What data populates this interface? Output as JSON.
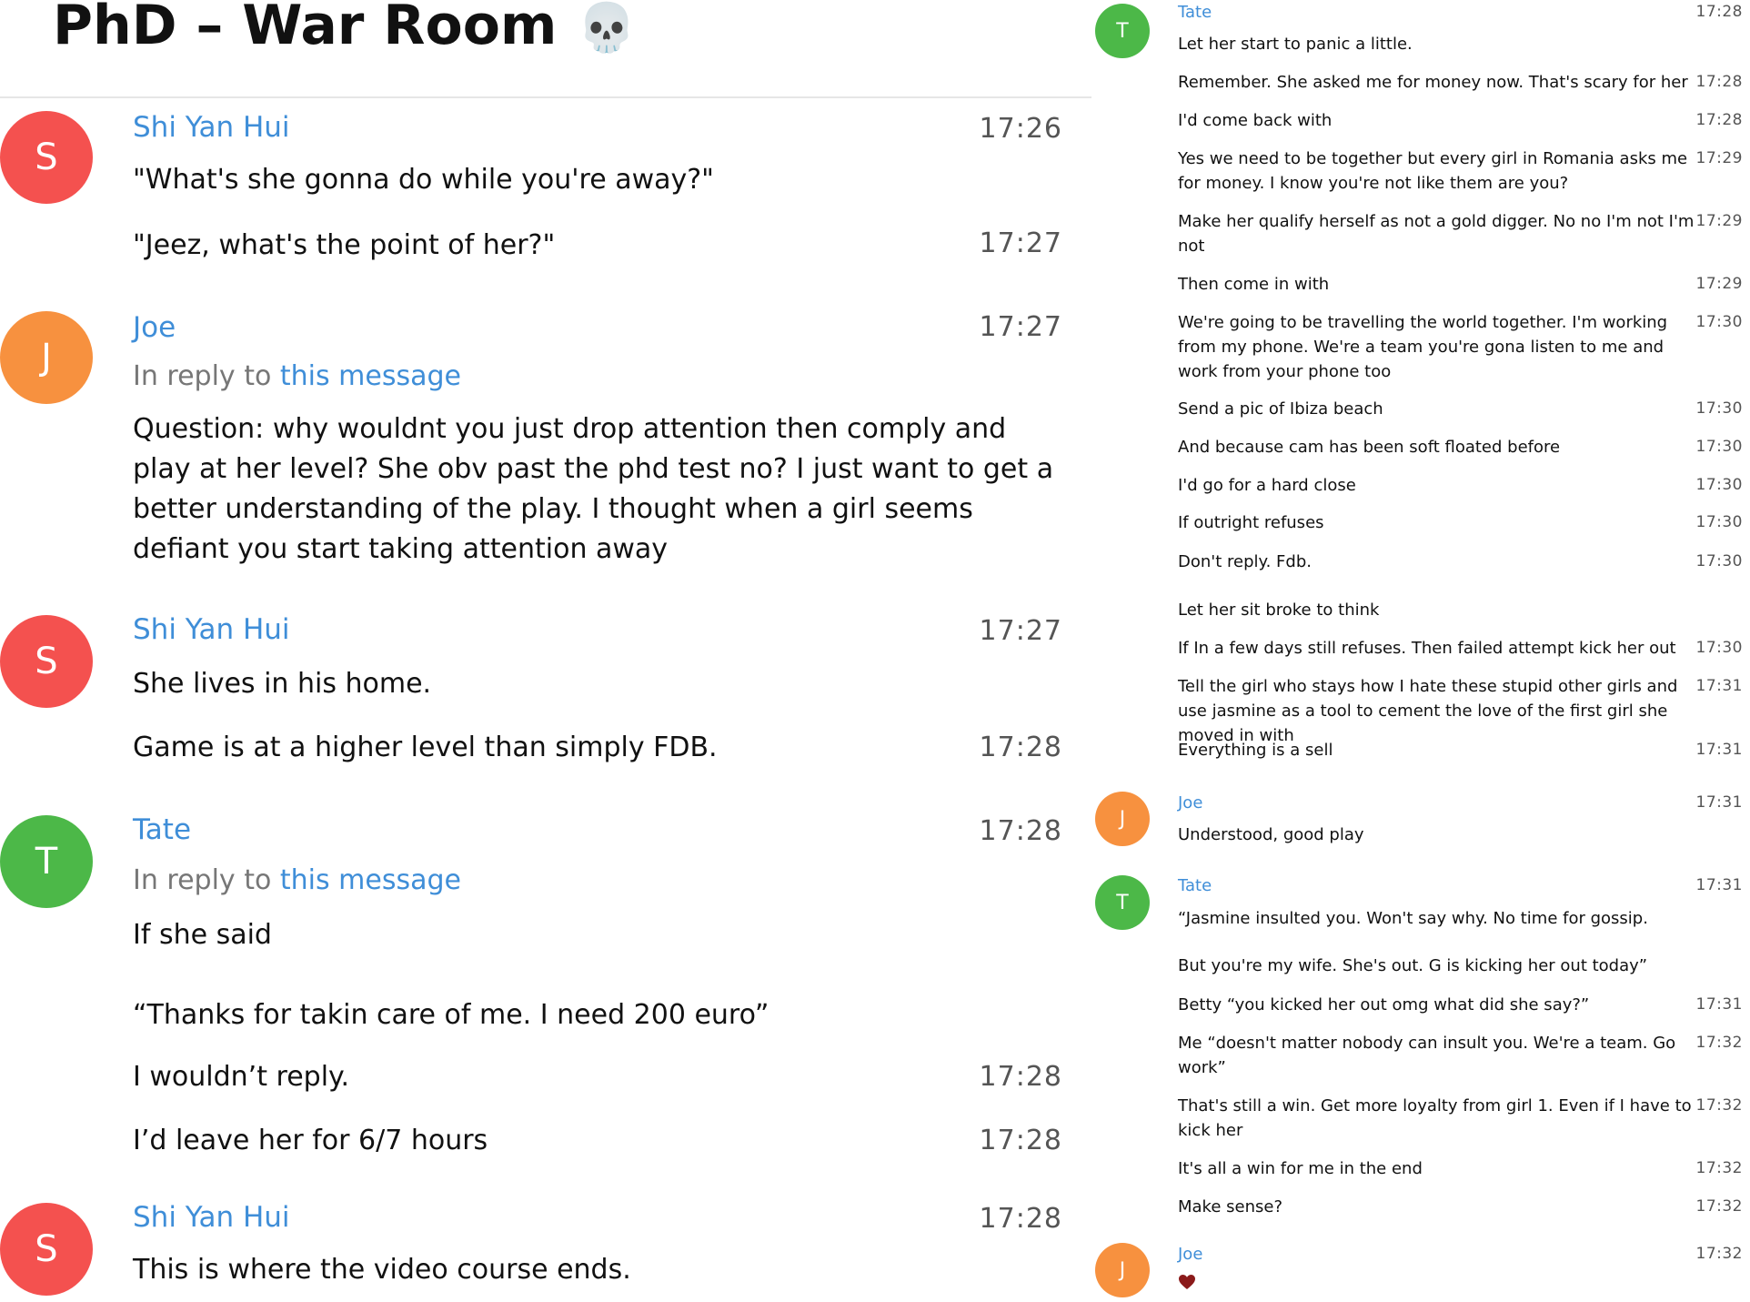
{
  "header": {
    "title": "PhD – War Room",
    "title_icon": "skull-icon",
    "skull_glyph": "💀"
  },
  "colors": {
    "red": "#f4514f",
    "orange": "#f7913f",
    "green": "#4cb848",
    "name_blue": "#3f8ed8"
  },
  "left": {
    "reply_prefix": "In reply to",
    "reply_link": "this message",
    "groups": [
      {
        "author": "Shi Yan Hui",
        "initial": "S",
        "messages": [
          {
            "text": "\"What's she gonna do while you're away?\"",
            "time": "17:26"
          },
          {
            "text": "\"Jeez, what's the point of her?\"",
            "time": "17:27"
          }
        ]
      },
      {
        "author": "Joe",
        "initial": "J",
        "messages": [
          {
            "text": "Question: why wouldnt you just drop attention then comply and play at her level? She obv past the phd test no? I just want to get a better understanding of the play. I thought when a girl seems defiant you start taking attention away",
            "time": "17:27"
          }
        ]
      },
      {
        "author": "Shi Yan Hui",
        "initial": "S",
        "messages": [
          {
            "text": "She lives in his home.",
            "time": "17:27"
          },
          {
            "text": "Game is at a higher level than simply FDB.",
            "time": "17:28"
          }
        ]
      },
      {
        "author": "Tate",
        "initial": "T",
        "messages": [
          {
            "text": "If she said",
            "time": "17:28"
          },
          {
            "text": "“Thanks for takin care of me. I need 200 euro”",
            "time": ""
          },
          {
            "text": "I wouldn’t reply.",
            "time": "17:28"
          },
          {
            "text": "I’d leave her for 6/7 hours",
            "time": "17:28"
          }
        ]
      },
      {
        "author": "Shi Yan Hui",
        "initial": "S",
        "messages": [
          {
            "text": "This is where the video course ends.",
            "time": "17:28"
          }
        ]
      }
    ]
  },
  "right": {
    "groups": [
      {
        "author": "Tate",
        "initial": "T",
        "messages": [
          {
            "text": "Let her start to panic a little.",
            "time": "17:28"
          },
          {
            "text": "Remember. She asked me for money now. That's scary for her",
            "time": "17:28"
          },
          {
            "text": "I'd come back with",
            "time": "17:28"
          },
          {
            "text": "Yes we need to be together but every girl in Romania asks me for money. I know you're not like them are you?",
            "time": "17:29"
          },
          {
            "text": "Make her qualify herself as not a gold digger. No no I'm not I'm not",
            "time": "17:29"
          },
          {
            "text": "Then come in with",
            "time": "17:29"
          },
          {
            "text": "We're going to be travelling the world together. I'm working from my phone. We're a team you're gona listen to me and work from your phone too",
            "time": "17:30"
          },
          {
            "text": "Send a pic of Ibiza beach",
            "time": "17:30"
          },
          {
            "text": "And because cam has been soft floated before",
            "time": "17:30"
          },
          {
            "text": "I'd go for a hard close",
            "time": "17:30"
          },
          {
            "text": "If outright refuses",
            "time": "17:30"
          },
          {
            "text": "Don't reply. Fdb.",
            "time": "17:30"
          },
          {
            "text": "Let her sit broke to think",
            "time": ""
          },
          {
            "text": "If In a few days still refuses. Then failed attempt kick her out",
            "time": "17:30"
          },
          {
            "text": "Tell the girl who stays how I hate these stupid other girls and use jasmine as a tool to cement the love of the first girl she moved in with",
            "time": "17:31"
          },
          {
            "text": "Everything is a sell",
            "time": "17:31"
          }
        ]
      },
      {
        "author": "Joe",
        "initial": "J",
        "messages": [
          {
            "text": "Understood, good play",
            "time": "17:31"
          }
        ]
      },
      {
        "author": "Tate",
        "initial": "T",
        "messages": [
          {
            "text": "“Jasmine insulted you. Won't say why. No time for gossip.",
            "time": "17:31"
          },
          {
            "text": "But you're my wife. She's out. G is kicking her out today”",
            "time": ""
          },
          {
            "text": "Betty “you kicked her out omg what did she say?”",
            "time": "17:31"
          },
          {
            "text": "Me “doesn't matter nobody can insult you. We're a team. Go work”",
            "time": "17:32"
          },
          {
            "text": "That's still a win. Get more loyalty from girl 1. Even if I have to kick her",
            "time": "17:32"
          },
          {
            "text": "It's all a win for me in the end",
            "time": "17:32"
          },
          {
            "text": "Make sense?",
            "time": "17:32"
          }
        ]
      },
      {
        "author": "Joe",
        "initial": "J",
        "messages": [
          {
            "text": "",
            "time": "17:32",
            "icon": "heart-icon"
          }
        ]
      }
    ]
  }
}
